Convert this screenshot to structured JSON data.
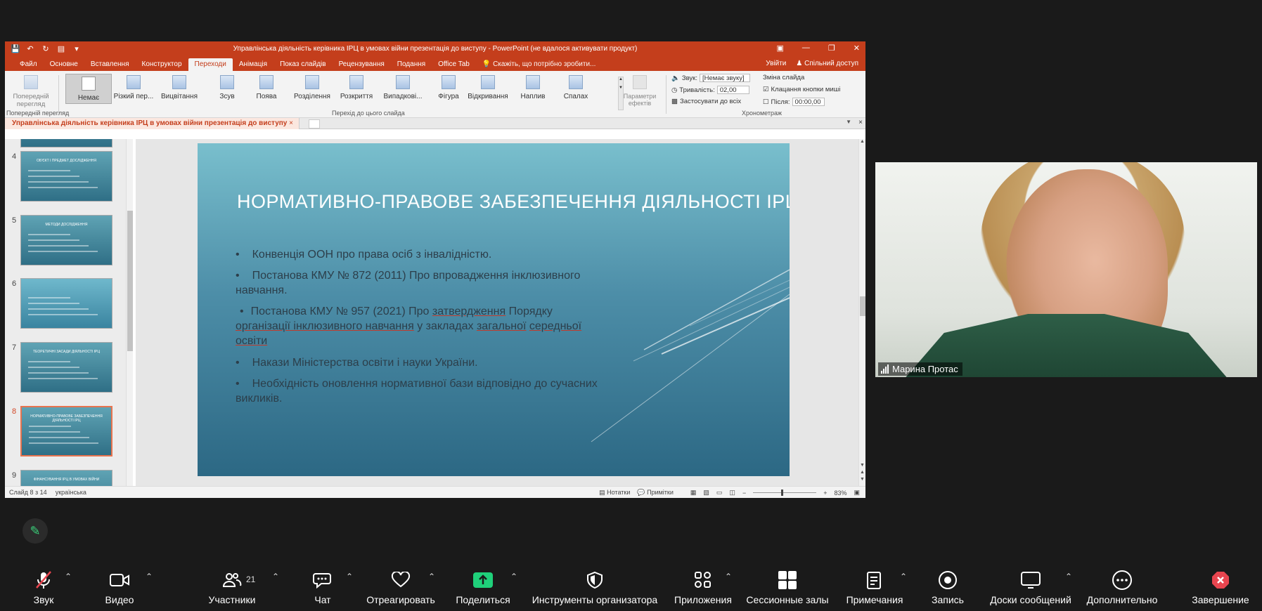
{
  "ppt": {
    "window_title": "Управлінська діяльність керівника ІРЦ в умовах війни презентація до виступу - PowerPoint (не вдалося активувати продукт)",
    "menu_tabs": [
      "Файл",
      "Основне",
      "Вставлення",
      "Конструктор",
      "Переходи",
      "Анімація",
      "Показ слайдів",
      "Рецензування",
      "Подання",
      "Office Tab"
    ],
    "active_tab": "Переходи",
    "tell_me": "Скажіть, що потрібно зробити...",
    "sign_in": "Увійти",
    "share": "Спільний доступ",
    "ribbon": {
      "preview_label": "Попередній перегляд",
      "preview_group": "Попередній перегляд",
      "transitions": [
        "Немає",
        "Різкий пер...",
        "Вицвітання",
        "Зсув",
        "Поява",
        "Розділення",
        "Розкриття",
        "Випадкові...",
        "Фігура",
        "Відкривання",
        "Наплив",
        "Спалах"
      ],
      "transitions_group": "Перехід до цього слайда",
      "effect_params": "Параметри ефектів",
      "sound_label": "Звук:",
      "sound_value": "[Немає звуку]",
      "duration_label": "Тривалість:",
      "duration_value": "02,00",
      "apply_all": "Застосувати до всіх",
      "change_slide": "Зміна слайда",
      "on_click": "Клацання кнопки миші",
      "after_label": "Після:",
      "after_value": "00:00,00",
      "timing_group": "Хронометраж"
    },
    "doc_tab": "Управлінська діяльність керівника ІРЦ в умовах війни презентація до виступу",
    "thumbnails": [
      {
        "num": "4",
        "title": "ОБ'ЄКТ І ПРЕДМЕТ ДОСЛІДЖЕННЯ"
      },
      {
        "num": "5",
        "title": "МЕТОДИ ДОСЛІДЖЕННЯ"
      },
      {
        "num": "6",
        "title": ""
      },
      {
        "num": "7",
        "title": "ТЕОРЕТИЧНІ ЗАСАДИ ДІЯЛЬНОСТІ ІРЦ"
      },
      {
        "num": "8",
        "title": "НОРМАТИВНО-ПРАВОВЕ ЗАБЕЗПЕЧЕННЯ ДІЯЛЬНОСТІ ІРЦ"
      },
      {
        "num": "9",
        "title": "ФІНАНСУВАННЯ ІРЦ В УМОВАХ ВІЙНИ"
      }
    ],
    "slide": {
      "title": "НОРМАТИВНО-ПРАВОВЕ ЗАБЕЗПЕЧЕННЯ ДІЯЛЬНОСТІ ІРЦ",
      "bullets": [
        "Конвенція ООН про права осіб з інвалідністю.",
        "Постанова КМУ № 872 (2011) Про впровадження інклюзивного навчання.",
        "Наказ Міністерства освіти і науки України.",
        "Необхідність оновлення нормативної бази відповідно до сучасних викликів."
      ],
      "bullet3_parts": [
        "Постанова КМУ № 957 (2021) Про ",
        "затвердження",
        " Порядку ",
        "організації інклюзивного навчання",
        " у закладах ",
        "загальної",
        " ",
        "середньої освіти"
      ],
      "bullet4": "Накази Міністерства освіти і науки України."
    },
    "status": {
      "slide_of": "Слайд 8 з 14",
      "language": "українська",
      "notes": "Нотатки",
      "comments": "Примітки",
      "zoom": "83%"
    }
  },
  "video": {
    "participant_name": "Марина Протас"
  },
  "toolbar": {
    "items": [
      {
        "label": "Звук",
        "icon": "mic-muted-icon"
      },
      {
        "label": "Видео",
        "icon": "video-camera-icon"
      },
      {
        "label": "Участники",
        "icon": "participants-icon",
        "count": "21"
      },
      {
        "label": "Чат",
        "icon": "chat-icon"
      },
      {
        "label": "Отреагировать",
        "icon": "heart-icon"
      },
      {
        "label": "Поделиться",
        "icon": "share-screen-icon"
      },
      {
        "label": "Инструменты организатора",
        "icon": "shield-icon"
      },
      {
        "label": "Приложения",
        "icon": "apps-icon"
      },
      {
        "label": "Сессионные залы",
        "icon": "breakout-rooms-icon"
      },
      {
        "label": "Примечания",
        "icon": "notes-icon"
      },
      {
        "label": "Запись",
        "icon": "record-icon"
      },
      {
        "label": "Доски сообщений",
        "icon": "whiteboard-icon"
      },
      {
        "label": "Дополнительно",
        "icon": "more-icon"
      },
      {
        "label": "Завершение",
        "icon": "end-icon"
      }
    ],
    "share_color": "#1fd07a",
    "end_color": "#e8454f"
  }
}
